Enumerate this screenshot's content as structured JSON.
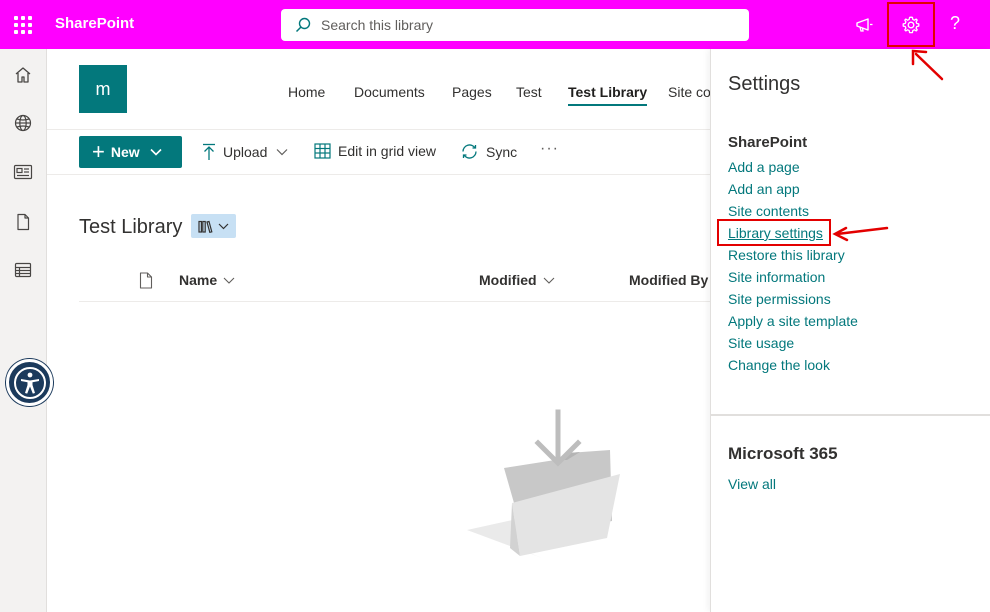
{
  "colors": {
    "topbar": "#ff00ff",
    "accent": "#03787c",
    "link": "#03787c",
    "highlight": "#e30000"
  },
  "header": {
    "app_name": "SharePoint",
    "search_placeholder": "Search this library",
    "icons": [
      "waffle-icon",
      "megaphone-icon",
      "gear-icon",
      "help-icon"
    ],
    "help_label": "?"
  },
  "rail": {
    "icons": [
      "home-icon",
      "globe-icon",
      "news-icon",
      "document-icon",
      "list-icon",
      "accessibility-icon"
    ]
  },
  "site": {
    "logo_letter": "m",
    "nav": [
      "Home",
      "Documents",
      "Pages",
      "Test",
      "Test Library",
      "Site co"
    ],
    "active_nav": "Test Library"
  },
  "commandbar": {
    "new_label": "New",
    "upload_label": "Upload",
    "grid_label": "Edit in grid view",
    "sync_label": "Sync",
    "more_label": "···"
  },
  "library": {
    "title": "Test Library",
    "columns": [
      "Name",
      "Modified",
      "Modified By"
    ]
  },
  "settings": {
    "title": "Settings",
    "sharepoint_title": "SharePoint",
    "links": [
      "Add a page",
      "Add an app",
      "Site contents",
      "Library settings",
      "Restore this library",
      "Site information",
      "Site permissions",
      "Apply a site template",
      "Site usage",
      "Change the look"
    ],
    "highlighted_link": "Library settings",
    "m365_title": "Microsoft 365",
    "view_all": "View all"
  }
}
